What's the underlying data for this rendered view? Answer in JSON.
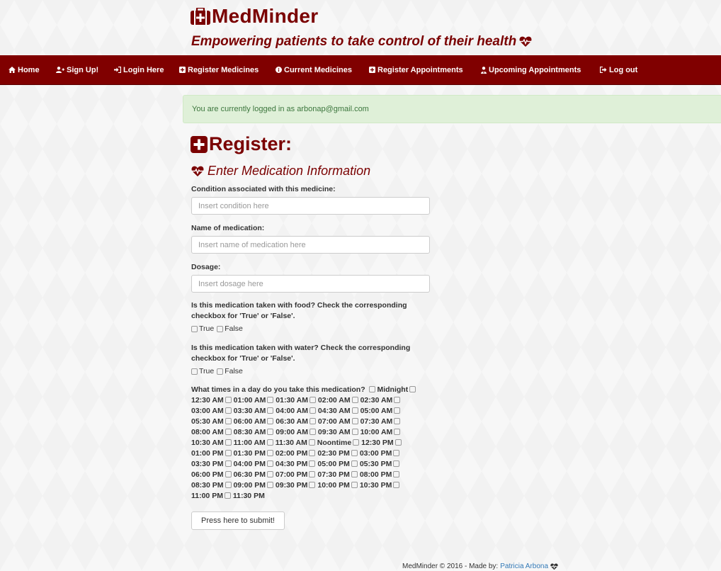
{
  "header": {
    "brand": "MedMinder",
    "tagline": "Empowering patients to take control of their health",
    "brand_icon": "medkit-icon",
    "tagline_icon": "heartbeat-icon"
  },
  "nav": [
    {
      "label": "Home",
      "icon": "home-icon"
    },
    {
      "label": "Sign Up!",
      "icon": "user-plus-icon"
    },
    {
      "label": "Login Here",
      "icon": "sign-in-icon"
    },
    {
      "label": "Register Medicines",
      "icon": "plus-square-icon"
    },
    {
      "label": "Current Medicines",
      "icon": "info-circle-icon"
    },
    {
      "label": "Register Appointments",
      "icon": "plus-square-icon"
    },
    {
      "label": "Upcoming Appointments",
      "icon": "user-md-icon"
    },
    {
      "label": "Log out",
      "icon": "sign-out-icon"
    }
  ],
  "alert": {
    "text": "You are currently logged in as arbonap@gmail.com"
  },
  "form": {
    "heading": "Register:",
    "subheading": "Enter Medication Information",
    "condition_label": "Condition associated with this medicine:",
    "condition_placeholder": "Insert condition here",
    "name_label": "Name of medication:",
    "name_placeholder": "Insert name of medication here",
    "dosage_label": "Dosage:",
    "dosage_placeholder": "Insert dosage here",
    "food_question": "Is this medication taken with food? Check the corresponding checkbox for 'True' or 'False'.",
    "water_question": "Is this medication taken with water? Check the corresponding checkbox for 'True' or 'False'.",
    "true_label": "True",
    "false_label": "False",
    "times_question": "What times in a day do you take this medication?",
    "times": [
      "Midnight",
      "12:30 AM",
      "01:00 AM",
      "01:30 AM",
      "02:00 AM",
      "02:30 AM",
      "03:00 AM",
      "03:30 AM",
      "04:00 AM",
      "04:30 AM",
      "05:00 AM",
      "05:30 AM",
      "06:00 AM",
      "06:30 AM",
      "07:00 AM",
      "07:30 AM",
      "08:00 AM",
      "08:30 AM",
      "09:00 AM",
      "09:30 AM",
      "10:00 AM",
      "10:30 AM",
      "11:00 AM",
      "11:30 AM",
      "Noontime",
      "12:30 PM",
      "01:00 PM",
      "01:30 PM",
      "02:00 PM",
      "02:30 PM",
      "03:00 PM",
      "03:30 PM",
      "04:00 PM",
      "04:30 PM",
      "05:00 PM",
      "05:30 PM",
      "06:00 PM",
      "06:30 PM",
      "07:00 PM",
      "07:30 PM",
      "08:00 PM",
      "08:30 PM",
      "09:00 PM",
      "09:30 PM",
      "10:00 PM",
      "10:30 PM",
      "11:00 PM",
      "11:30 PM"
    ],
    "submit_label": "Press here to submit!"
  },
  "footer": {
    "text": "MedMinder © 2016 - Made by:",
    "author": "Patricia Arbona"
  },
  "colors": {
    "brand": "#800000",
    "alert_bg": "#dff0d8",
    "alert_text": "#3c763d",
    "link": "#337ab7"
  }
}
